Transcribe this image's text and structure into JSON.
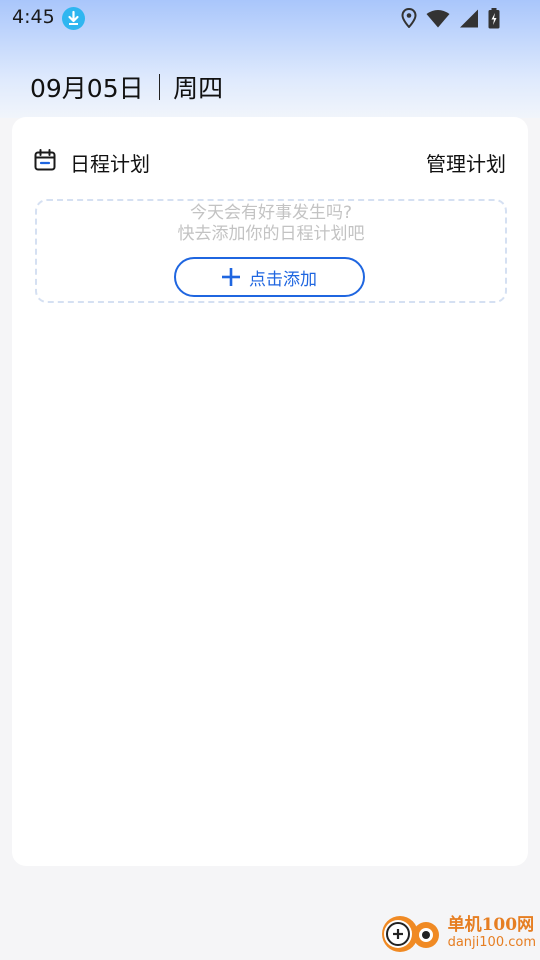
{
  "status_bar": {
    "time": "4:45",
    "icons": [
      "download-icon",
      "location-icon",
      "wifi-icon",
      "cellular-icon",
      "battery-icon"
    ],
    "accent": "#2fb6f0"
  },
  "header": {
    "date": "09月05日",
    "weekday": "周四"
  },
  "schedule": {
    "title": "日程计划",
    "manage_label": "管理计划",
    "empty_line1": "今天会有好事发生吗?",
    "empty_line2": "快去添加你的日程计划吧",
    "add_label": "点击添加",
    "accent": "#1f66e0"
  },
  "watermark": {
    "line1": "单机100网",
    "line2": "danji100.com"
  }
}
